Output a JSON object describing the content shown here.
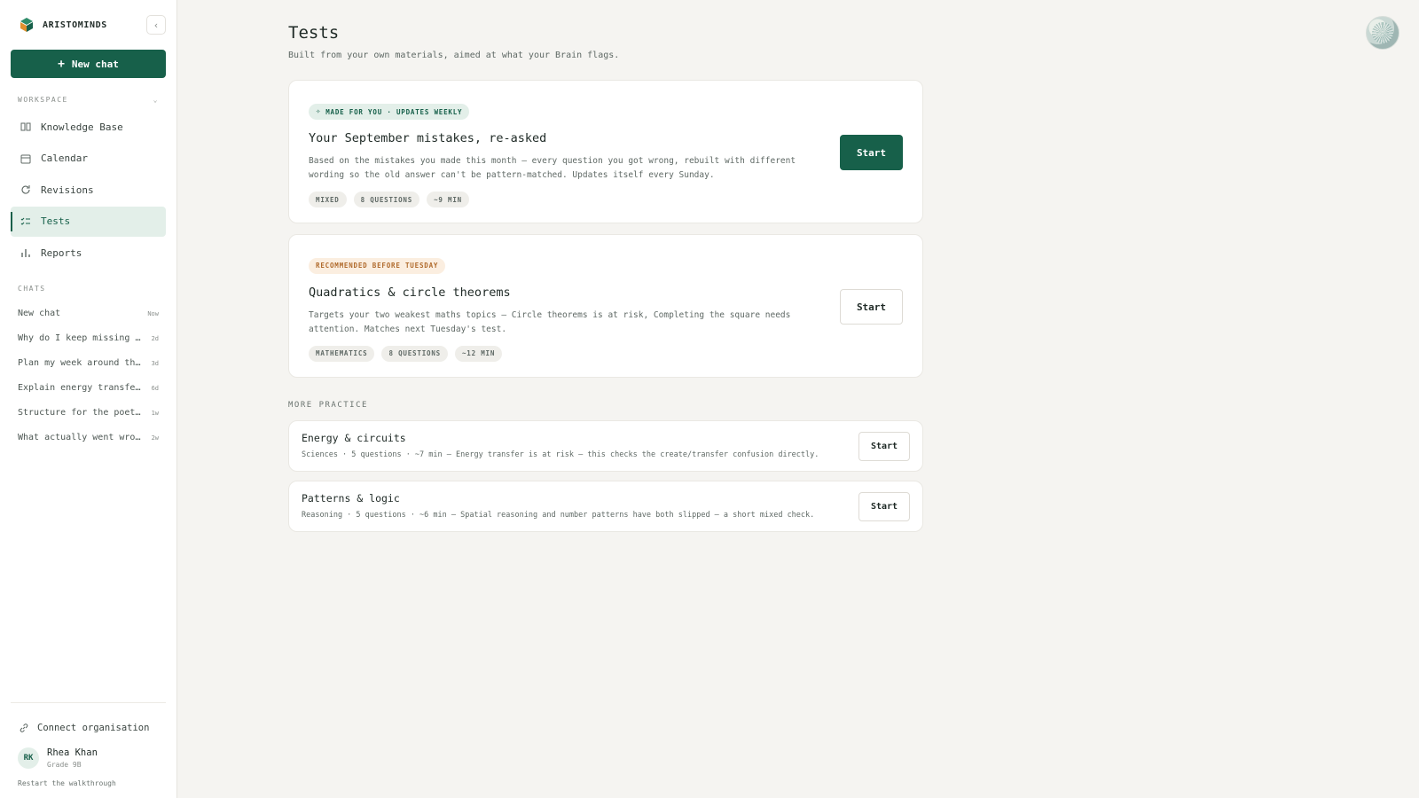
{
  "brand": {
    "name": "ARISTOMINDS"
  },
  "sidebar": {
    "new_chat_label": "New chat",
    "workspace_label": "WORKSPACE",
    "nav": [
      {
        "label": "Knowledge Base",
        "icon": "book-icon"
      },
      {
        "label": "Calendar",
        "icon": "calendar-icon"
      },
      {
        "label": "Revisions",
        "icon": "refresh-icon"
      },
      {
        "label": "Tests",
        "icon": "checklist-icon",
        "active": true
      },
      {
        "label": "Reports",
        "icon": "bar-chart-icon"
      }
    ],
    "chats_label": "CHATS",
    "chats": [
      {
        "title": "New chat",
        "time": "Now"
      },
      {
        "title": "Why do I keep missing c…",
        "time": "2d"
      },
      {
        "title": "Plan my week around the…",
        "time": "3d"
      },
      {
        "title": "Explain energy transfer…",
        "time": "6d"
      },
      {
        "title": "Structure for the poetr…",
        "time": "1w"
      },
      {
        "title": "What actually went wron…",
        "time": "2w"
      }
    ],
    "connect_org": "Connect organisation",
    "user": {
      "initials": "RK",
      "name": "Rhea Khan",
      "grade": "Grade 9B"
    },
    "restart": "Restart the walkthrough"
  },
  "main": {
    "title": "Tests",
    "subtitle": "Built from your own materials, aimed at what your Brain flags.",
    "featured": [
      {
        "badge": "MADE FOR YOU · UPDATES WEEKLY",
        "title": "Your September mistakes, re-asked",
        "desc_line1": "Based on the mistakes you made this month — every question you got wrong, rebuilt with different",
        "desc_line2": "wording so the old answer can't be pattern-matched. Updates itself every Sunday.",
        "tags": [
          "MIXED",
          "8 QUESTIONS",
          "~9 MIN"
        ],
        "button": "Start"
      },
      {
        "badge": "RECOMMENDED BEFORE TUESDAY",
        "title": "Quadratics & circle theorems",
        "desc_line1": "Targets your two weakest maths topics — Circle theorems is at risk, Completing the square needs",
        "desc_line2": "attention. Matches next Tuesday's test.",
        "tags": [
          "MATHEMATICS",
          "8 QUESTIONS",
          "~12 MIN"
        ],
        "button": "Start"
      }
    ],
    "more_label": "MORE PRACTICE",
    "practice": [
      {
        "title": "Energy & circuits",
        "desc": "Sciences · 5 questions · ~7 min — Energy transfer is at risk — this checks the create/transfer confusion directly.",
        "button": "Start"
      },
      {
        "title": "Patterns & logic",
        "desc": "Reasoning · 5 questions · ~6 min — Spatial reasoning and number patterns have both slipped — a short mixed check.",
        "button": "Start"
      }
    ]
  },
  "colors": {
    "accent": "#17604a",
    "badge_orange": "#b06a2c",
    "background": "#f5f4f1"
  }
}
